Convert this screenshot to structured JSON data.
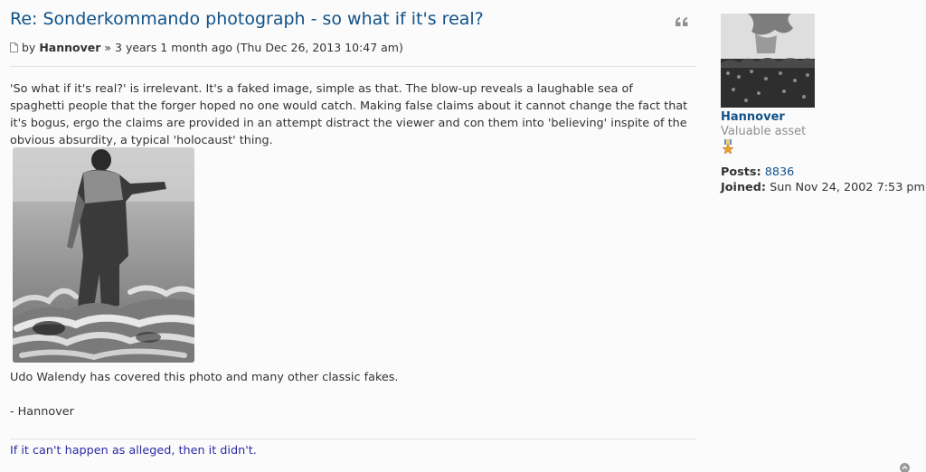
{
  "post": {
    "title": "Re: Sonderkommando photograph - so what if it's real?",
    "meta": {
      "by": "by",
      "author": "Hannover",
      "time": "» 3 years 1 month ago (Thu Dec 26, 2013 10:47 am)"
    },
    "body": {
      "paragraph": "'So what if it's real?' is irrelevant. It's a faked image, simple as that. The blow-up reveals a laughable sea of spaghetti people that the forger hoped no one would catch. Making false claims about it cannot change the fact that it's bogus, ergo the claims are provided in an attempt distract the viewer and con them into 'believing' inspite of the obvious absurdity, a typical 'holocaust' thing.",
      "after_image": "Udo Walendy has covered this photo and many other classic fakes.",
      "closing": "- Hannover"
    },
    "signature": "If it can't happen as alleged, then it didn't."
  },
  "profile": {
    "username": "Hannover",
    "rank": "Valuable asset",
    "posts_label": "Posts:",
    "posts_value": "8836",
    "joined_label": "Joined:",
    "joined_value": "Sun Nov 24, 2002 7:53 pm"
  },
  "icons": {
    "quote": "quote-icon",
    "page": "page-icon",
    "rank": "rank-star-icon",
    "top": "back-to-top-icon"
  }
}
